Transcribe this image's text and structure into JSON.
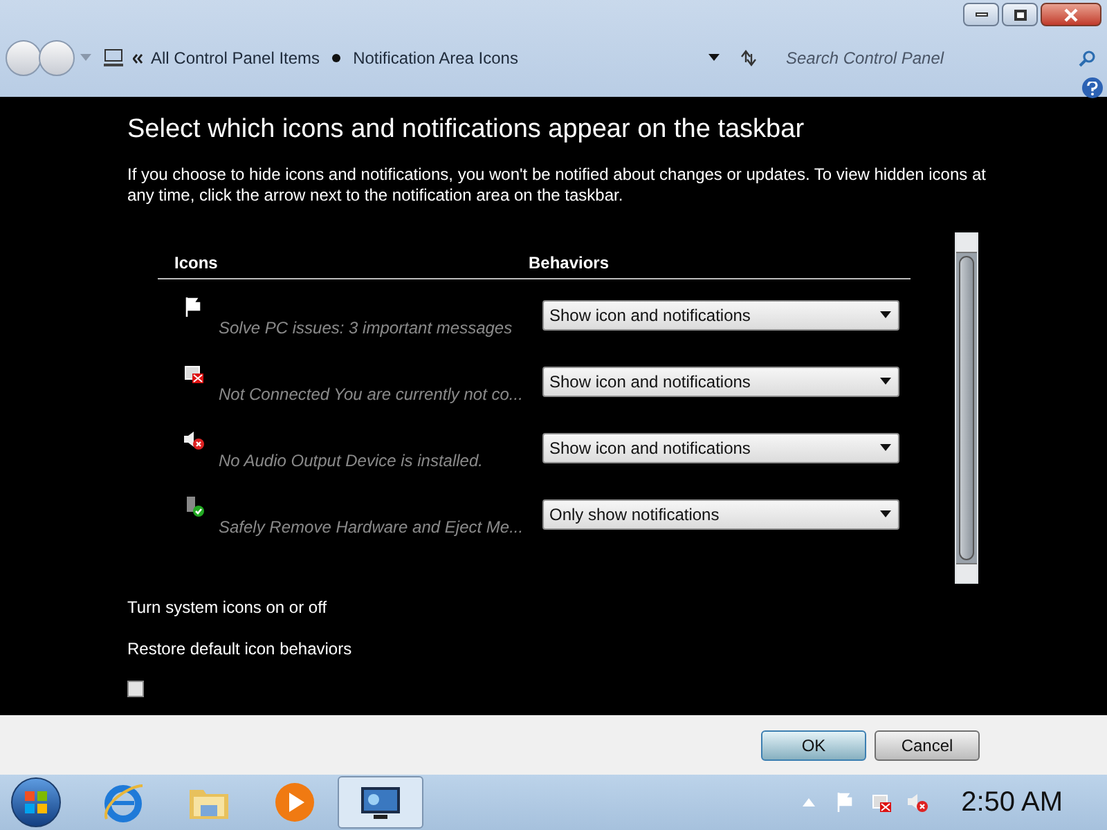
{
  "address_bar": {
    "breadcrumbs": [
      "All Control Panel Items",
      "Notification Area Icons"
    ],
    "search": {
      "placeholder": "Search Control Panel"
    }
  },
  "heading": "Select which icons and notifications appear on the taskbar",
  "description": "If you choose to hide icons and notifications, you won't be notified about changes or updates. To view hidden icons at any time, click the arrow next to the notification area on the taskbar.",
  "table": {
    "columns": [
      "Icons",
      "Behaviors"
    ],
    "rows": [
      {
        "kind": "flag",
        "name": "Solve PC issues: 3 important messages",
        "behavior": "Show icon and notifications"
      },
      {
        "kind": "network",
        "name": "Not Connected You are currently not co...",
        "behavior": "Show icon and notifications"
      },
      {
        "kind": "speaker",
        "name": "No Audio Output Device is installed.",
        "behavior": "Show icon and notifications"
      },
      {
        "kind": "usb",
        "name": "Safely Remove Hardware and Eject Me...",
        "behavior": "Only show notifications"
      }
    ]
  },
  "links": [
    "Turn system icons on or off",
    "Restore default icon behaviors"
  ],
  "always_show": {
    "checked": false
  },
  "buttons": [
    "OK",
    "Cancel"
  ],
  "taskbar": {
    "apps": [
      {
        "kind": "browser",
        "selected": false
      },
      {
        "kind": "folder",
        "selected": false
      },
      {
        "kind": "media",
        "selected": false
      },
      {
        "kind": "control",
        "selected": true
      }
    ],
    "tray": [
      {
        "kind": "flag"
      },
      {
        "kind": "network"
      },
      {
        "kind": "speaker"
      }
    ],
    "clock": "2:50 AM"
  }
}
